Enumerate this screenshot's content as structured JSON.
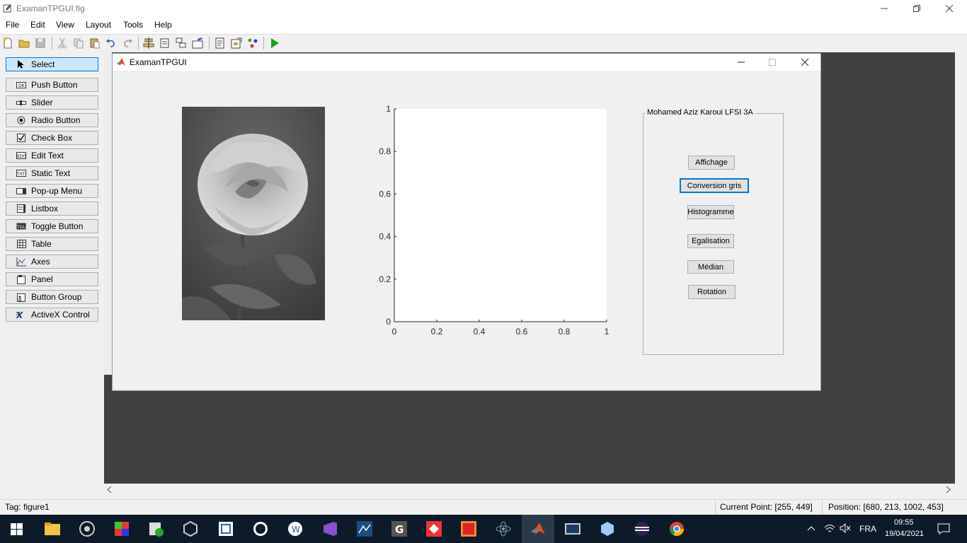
{
  "app": {
    "title": "ExamanTPGUI.fig"
  },
  "menu": [
    "File",
    "Edit",
    "View",
    "Layout",
    "Tools",
    "Help"
  ],
  "palette": [
    {
      "label": "Select",
      "icon": "arrow-cursor-icon"
    },
    {
      "label": "Push Button",
      "icon": "push-button-icon"
    },
    {
      "label": "Slider",
      "icon": "slider-icon"
    },
    {
      "label": "Radio Button",
      "icon": "radio-button-icon"
    },
    {
      "label": "Check Box",
      "icon": "check-box-icon"
    },
    {
      "label": "Edit Text",
      "icon": "edit-text-icon"
    },
    {
      "label": "Static Text",
      "icon": "static-text-icon"
    },
    {
      "label": "Pop-up Menu",
      "icon": "popup-menu-icon"
    },
    {
      "label": "Listbox",
      "icon": "listbox-icon"
    },
    {
      "label": "Toggle Button",
      "icon": "toggle-button-icon"
    },
    {
      "label": "Table",
      "icon": "table-icon"
    },
    {
      "label": "Axes",
      "icon": "axes-icon"
    },
    {
      "label": "Panel",
      "icon": "panel-icon"
    },
    {
      "label": "Button Group",
      "icon": "button-group-icon"
    },
    {
      "label": "ActiveX Control",
      "icon": "activex-icon"
    }
  ],
  "figure": {
    "title": "ExamanTPGUI",
    "panel_title": "Mohamed Aziz Karoui LFSI 3A",
    "buttons": [
      "Affichage",
      "Conversion gris",
      "Histogramme",
      "Egalisation",
      "Médian",
      "Rotation"
    ]
  },
  "chart_data": {
    "type": "line",
    "title": "",
    "xlabel": "",
    "ylabel": "",
    "xlim": [
      0,
      1
    ],
    "ylim": [
      0,
      1
    ],
    "x_ticks": [
      "0",
      "0.2",
      "0.4",
      "0.6",
      "0.8",
      "1"
    ],
    "y_ticks": [
      "0",
      "0.2",
      "0.4",
      "0.6",
      "0.8",
      "1"
    ],
    "series": []
  },
  "status": {
    "tag": "Tag: figure1",
    "current_point": "Current Point:  [255, 449]",
    "position": "Position: [680, 213, 1002, 453]"
  },
  "taskbar": {
    "language": "FRA",
    "time": "09:55",
    "date": "19/04/2021"
  },
  "colors": {
    "accent": "#0078d7",
    "canvas": "#404040",
    "taskbar": "#0c1a2a"
  }
}
